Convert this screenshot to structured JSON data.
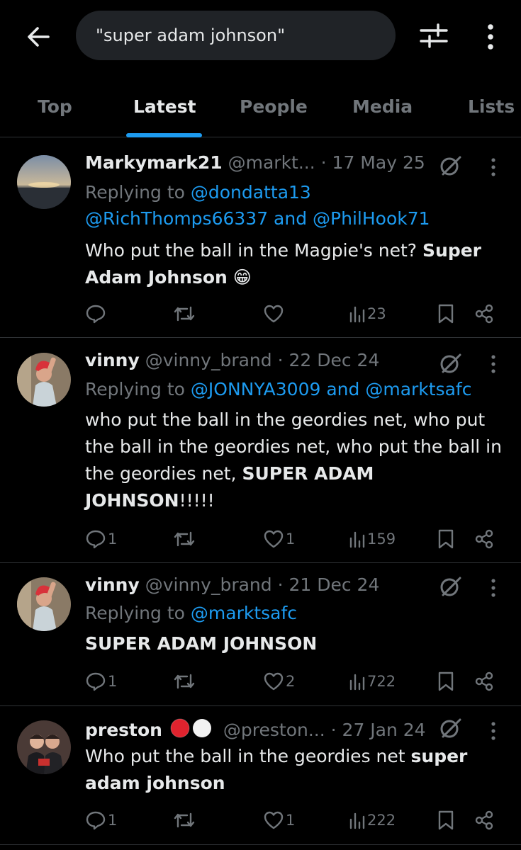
{
  "search": {
    "query": "\"super adam johnson\""
  },
  "tabs": [
    "Top",
    "Latest",
    "People",
    "Media",
    "Lists"
  ],
  "active_tab": "Latest",
  "tweets": [
    {
      "name": "Markymark21",
      "handle": "@markt...",
      "date": "· 17 May 25",
      "replying_prefix": "Replying to ",
      "replying_line1": "@dondatta13",
      "replying_line2a": "@RichThomps66337",
      "replying_and": " and ",
      "replying_line2b": "@PhilHook71",
      "text_plain": "Who put the ball in the Magpie's net? ",
      "text_bold": "Super Adam Johnson",
      "emoji": "😁",
      "replies": "",
      "reposts": "",
      "likes": "",
      "views": "23"
    },
    {
      "name": "vinny",
      "handle": "@vinny_brand",
      "date": "· 22 Dec 24",
      "replying_prefix": "Replying to ",
      "replying_a": "@JONNYA3009",
      "replying_and": " and ",
      "replying_b": "@marktsafc",
      "text_plain": "who put the ball in the geordies net, who put the ball in the geordies net, who put the ball in the geordies net, ",
      "text_bold": "SUPER ADAM JOHNSON",
      "text_tail": "!!!!!",
      "replies": "1",
      "reposts": "",
      "likes": "1",
      "views": "159"
    },
    {
      "name": "vinny",
      "handle": "@vinny_brand",
      "date": "· 21 Dec 24",
      "replying_prefix": "Replying to ",
      "replying_a": "@marktsafc",
      "text_bold": "SUPER ADAM JOHNSON",
      "replies": "1",
      "reposts": "",
      "likes": "2",
      "views": "722"
    },
    {
      "name": "preston",
      "handle": "@preston...",
      "date": "· 27 Jan 24",
      "text_plain": "Who put the ball in the geordies net ",
      "text_bold": "super adam johnson",
      "replies": "1",
      "reposts": "",
      "likes": "1",
      "views": "222"
    }
  ],
  "colors": {
    "accent": "#1d9bf0",
    "background": "#000000",
    "muted": "#71767b",
    "text": "#e7e9ea"
  },
  "icons": [
    "back-arrow-icon",
    "filter-sliders-icon",
    "more-vertical-icon",
    "grok-icon",
    "reply-icon",
    "repost-icon",
    "like-icon",
    "views-icon",
    "bookmark-icon",
    "share-icon"
  ]
}
